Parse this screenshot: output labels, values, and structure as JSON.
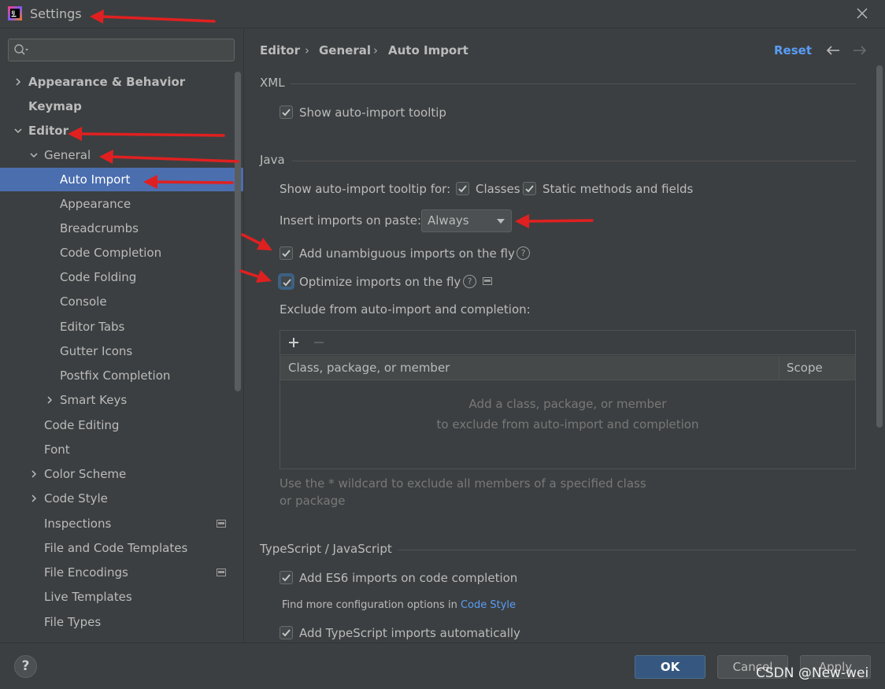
{
  "window": {
    "title": "Settings"
  },
  "sidebar": {
    "search_placeholder": "",
    "items": [
      {
        "label": "Appearance & Behavior",
        "expanded": false
      },
      {
        "label": "Keymap"
      },
      {
        "label": "Editor",
        "expanded": true
      },
      {
        "label": "General",
        "expanded": true
      },
      {
        "label": "Auto Import",
        "selected": true
      },
      {
        "label": "Appearance"
      },
      {
        "label": "Breadcrumbs"
      },
      {
        "label": "Code Completion"
      },
      {
        "label": "Code Folding"
      },
      {
        "label": "Console"
      },
      {
        "label": "Editor Tabs"
      },
      {
        "label": "Gutter Icons"
      },
      {
        "label": "Postfix Completion"
      },
      {
        "label": "Smart Keys",
        "expanded": false
      },
      {
        "label": "Code Editing"
      },
      {
        "label": "Font"
      },
      {
        "label": "Color Scheme",
        "expanded": false
      },
      {
        "label": "Code Style",
        "expanded": false
      },
      {
        "label": "Inspections"
      },
      {
        "label": "File and Code Templates"
      },
      {
        "label": "File Encodings"
      },
      {
        "label": "Live Templates"
      },
      {
        "label": "File Types"
      }
    ]
  },
  "header": {
    "breadcrumb": [
      "Editor",
      "General",
      "Auto Import"
    ],
    "separator": "›",
    "reset": "Reset"
  },
  "xml": {
    "title": "XML",
    "show_tooltip": {
      "label": "Show auto-import tooltip",
      "checked": true
    }
  },
  "java": {
    "title": "Java",
    "tooltip_for_label": "Show auto-import tooltip for:",
    "classes": {
      "label": "Classes",
      "checked": true
    },
    "static_methods": {
      "label": "Static methods and fields",
      "checked": true
    },
    "insert_on_paste_label": "Insert imports on paste:",
    "insert_on_paste_value": "Always",
    "add_unambiguous": {
      "label": "Add unambiguous imports on the fly",
      "checked": true
    },
    "optimize_imports": {
      "label": "Optimize imports on the fly",
      "checked": true
    },
    "exclude_label": "Exclude from auto-import and completion:",
    "table": {
      "columns": [
        "Class, package, or member",
        "Scope"
      ],
      "empty_line1": "Add a class, package, or member",
      "empty_line2": "to exclude from auto-import and completion",
      "add": "+",
      "remove": "−"
    },
    "hint": "Use the * wildcard to exclude all members of a specified class or package"
  },
  "ts": {
    "title": "TypeScript / JavaScript",
    "es6": {
      "label": "Add ES6 imports on code completion",
      "checked": true
    },
    "more_text": "Find more configuration options in",
    "more_link": "Code Style",
    "ts_auto": {
      "label": "Add TypeScript imports automatically",
      "checked": true
    }
  },
  "footer": {
    "help": "?",
    "ok": "OK",
    "cancel": "Cancel",
    "apply": "Apply",
    "watermark": "CSDN @New-wei"
  },
  "colors": {
    "background": "#3c3f41",
    "selection": "#4b6eaf",
    "link": "#589df6",
    "primary_button": "#365880",
    "annotation_arrow": "#e02020"
  }
}
